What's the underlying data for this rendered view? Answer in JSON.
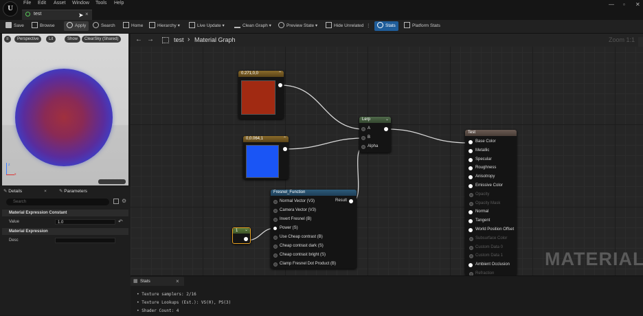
{
  "menu": [
    "File",
    "Edit",
    "Asset",
    "Window",
    "Tools",
    "Help"
  ],
  "logo": "U",
  "tab": {
    "title": "test",
    "close": "×"
  },
  "window_controls": [
    "—",
    "▫",
    "✕"
  ],
  "toolbar": {
    "save": "Save",
    "browse": "Browse",
    "apply": "Apply",
    "search": "Search",
    "home": "Home",
    "hierarchy": "Hierarchy",
    "live_update": "Live Update",
    "clean_graph": "Clean Graph",
    "preview_state": "Preview State",
    "hide_unrelated": "Hide Unrelated",
    "stats": "Stats",
    "platform_stats": "Platform Stats"
  },
  "viewport": {
    "buttons": [
      "Perspective",
      "Lit",
      "Show",
      "ClearSky (Shared)"
    ],
    "axis_z": "z",
    "axis_x": "x"
  },
  "details": {
    "tab_details": "Details",
    "tab_parameters": "Parameters",
    "search_placeholder": "Search",
    "cat1": "Material Expression Constant",
    "value_label": "Value",
    "value": "1.0",
    "cat2": "Material Expression",
    "desc_label": "Desc"
  },
  "graph": {
    "breadcrumb_root": "test",
    "breadcrumb_sep": "›",
    "breadcrumb_page": "Material Graph",
    "zoom": "Zoom 1:1"
  },
  "nodes": {
    "color1": {
      "title": "0.271,0,0",
      "color": "#a12a12"
    },
    "color2": {
      "title": "0,0.064,1",
      "color": "#1a55f5"
    },
    "lerp": {
      "title": "Lerp",
      "pins": [
        "A",
        "B",
        "Alpha"
      ]
    },
    "fresnel": {
      "title": "Fresnel_Function",
      "result": "Result",
      "inputs": [
        "Normal Vector (V3)",
        "Camera Vector (V3)",
        "Invert Fresnel (B)",
        "Power (S)",
        "Use Cheap contrast (B)",
        "Cheap contrast dark (S)",
        "Cheap contrast bright (S)",
        "Clamp Fresnel Dot Product (B)"
      ]
    },
    "const": {
      "title": "1"
    },
    "result": {
      "title": "Test",
      "inputs": [
        {
          "label": "Base Color",
          "active": true
        },
        {
          "label": "Metallic",
          "active": true
        },
        {
          "label": "Specular",
          "active": true
        },
        {
          "label": "Roughness",
          "active": true
        },
        {
          "label": "Anisotropy",
          "active": true
        },
        {
          "label": "Emissive Color",
          "active": true
        },
        {
          "label": "Opacity",
          "active": false
        },
        {
          "label": "Opacity Mask",
          "active": false
        },
        {
          "label": "Normal",
          "active": true
        },
        {
          "label": "Tangent",
          "active": true
        },
        {
          "label": "World Position Offset",
          "active": true
        },
        {
          "label": "Subsurface Color",
          "active": false
        },
        {
          "label": "Custom Data 0",
          "active": false
        },
        {
          "label": "Custom Data 1",
          "active": false
        },
        {
          "label": "Ambient Occlusion",
          "active": true
        },
        {
          "label": "Refraction",
          "active": false
        }
      ]
    }
  },
  "watermark": "MATERIAL",
  "stats": {
    "title": "Stats",
    "close": "×",
    "lines": [
      "• Texture samplers: 2/16",
      "• Texture Lookups (Est.): VS(0), PS(3)",
      "• Shader Count: 4"
    ]
  }
}
